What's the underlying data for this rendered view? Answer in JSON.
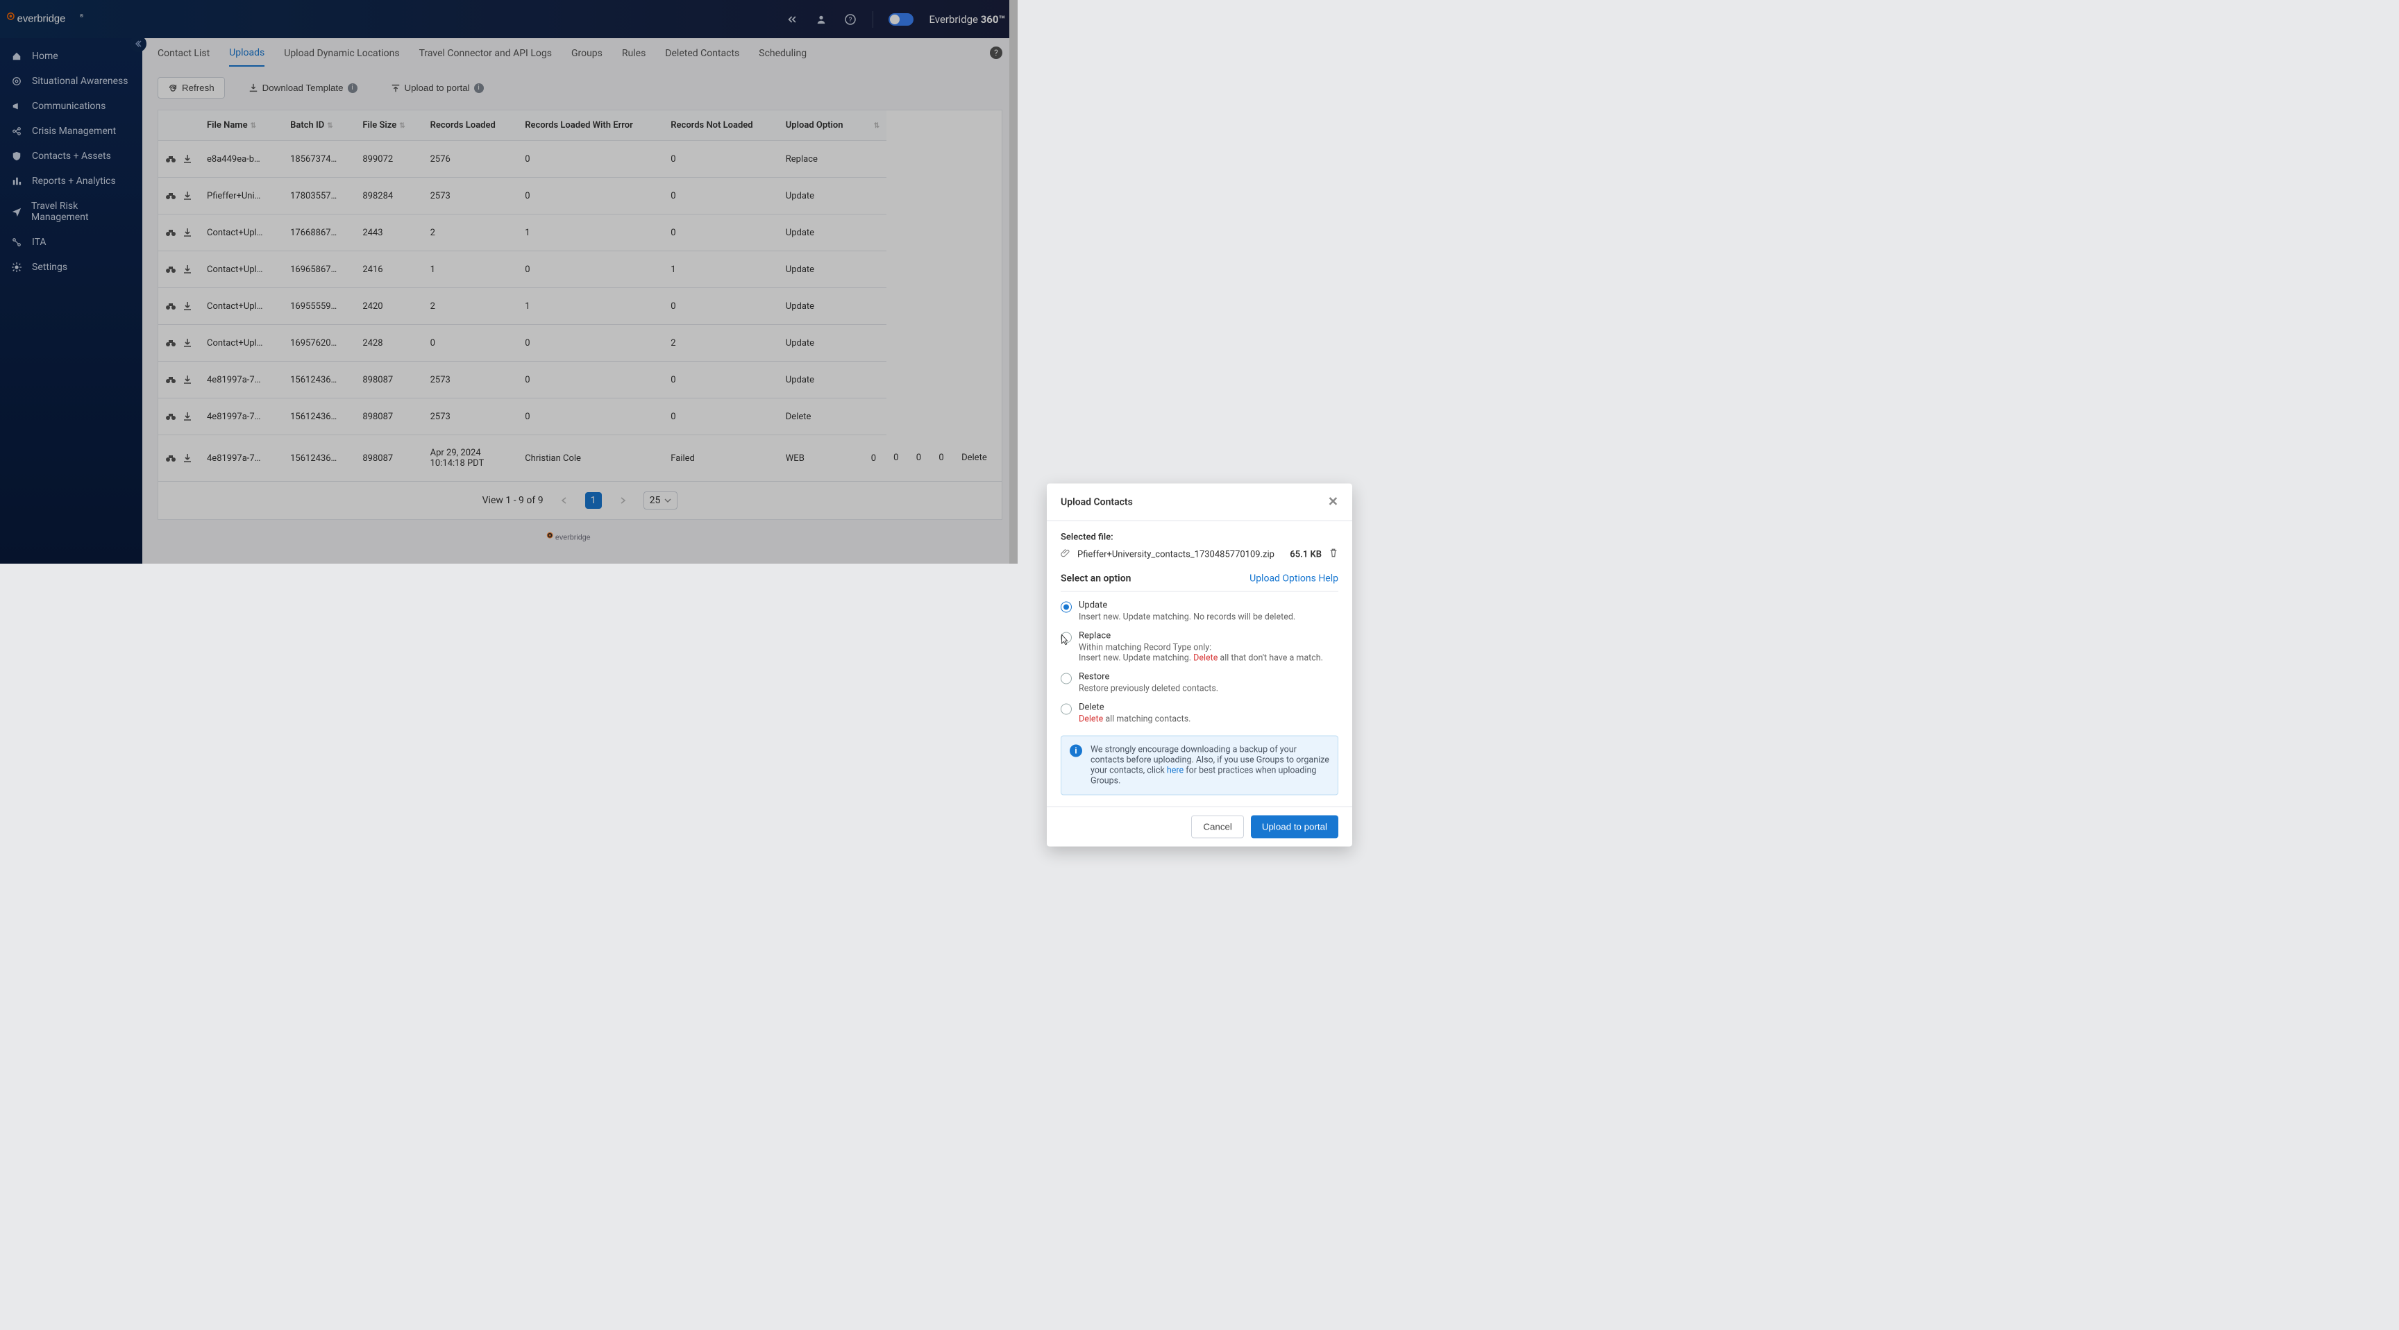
{
  "header": {
    "brand_right_prefix": "Everbridge ",
    "brand_right_suffix": "360™"
  },
  "sidebar": {
    "items": [
      {
        "label": "Home"
      },
      {
        "label": "Situational Awareness"
      },
      {
        "label": "Communications"
      },
      {
        "label": "Crisis Management"
      },
      {
        "label": "Contacts + Assets"
      },
      {
        "label": "Reports + Analytics"
      },
      {
        "label": "Travel Risk Management"
      },
      {
        "label": "ITA"
      },
      {
        "label": "Settings"
      }
    ]
  },
  "tabs": [
    "Contact List",
    "Uploads",
    "Upload Dynamic Locations",
    "Travel Connector and API Logs",
    "Groups",
    "Rules",
    "Deleted Contacts",
    "Scheduling"
  ],
  "active_tab_index": 1,
  "toolbar": {
    "refresh": "Refresh",
    "download_template": "Download Template",
    "upload_to_portal": "Upload to portal"
  },
  "columns": [
    "File Name",
    "Batch ID",
    "File Size",
    "Records Loaded",
    "Records Loaded With Error",
    "Records Not Loaded",
    "Upload Option"
  ],
  "rows": [
    {
      "file": "e8a449ea-b…",
      "batch": "18567374…",
      "size": "899072",
      "loaded": "2576",
      "err": "0",
      "not": "0",
      "opt": "Replace"
    },
    {
      "file": "Pfieffer+Uni…",
      "batch": "17803557…",
      "size": "898284",
      "loaded": "2573",
      "err": "0",
      "not": "0",
      "opt": "Update"
    },
    {
      "file": "Contact+Upl…",
      "batch": "17668867…",
      "size": "2443",
      "loaded": "2",
      "err": "1",
      "not": "0",
      "opt": "Update"
    },
    {
      "file": "Contact+Upl…",
      "batch": "16965867…",
      "size": "2416",
      "loaded": "1",
      "err": "0",
      "not": "1",
      "opt": "Update"
    },
    {
      "file": "Contact+Upl…",
      "batch": "16955559…",
      "size": "2420",
      "loaded": "2",
      "err": "1",
      "not": "0",
      "opt": "Update"
    },
    {
      "file": "Contact+Upl…",
      "batch": "16957620…",
      "size": "2428",
      "loaded": "0",
      "err": "0",
      "not": "2",
      "opt": "Update"
    },
    {
      "file": "4e81997a-7…",
      "batch": "15612436…",
      "size": "898087",
      "loaded": "2573",
      "err": "0",
      "not": "0",
      "opt": "Update"
    },
    {
      "file": "4e81997a-7…",
      "batch": "15612436…",
      "size": "898087",
      "loaded": "2573",
      "err": "0",
      "not": "0",
      "opt": "Delete"
    },
    {
      "file": "4e81997a-7…",
      "batch": "15612436…",
      "size": "898087",
      "date": "Apr 29, 2024 10:14:18 PDT",
      "by": "Christian Cole",
      "status": "Failed",
      "source": "WEB",
      "received": "0",
      "loaded": "0",
      "err": "0",
      "not": "0",
      "opt": "Delete"
    }
  ],
  "pagination": {
    "view_text": "View 1 - 9 of 9",
    "page": "1",
    "page_size": "25"
  },
  "modal": {
    "title": "Upload Contacts",
    "selected_file_label": "Selected file:",
    "file_name": "Pfieffer+University_contacts_1730485770109.zip",
    "file_size": "65.1 KB",
    "select_option_label": "Select an option",
    "upload_options_help": "Upload Options Help",
    "options": {
      "update": {
        "title": "Update",
        "sub": "Insert new. Update matching. No records will be deleted."
      },
      "replace": {
        "title": "Replace",
        "sub1": "Within matching Record Type only:",
        "sub2a": "Insert new. Update matching. ",
        "sub2_delete": "Delete",
        "sub2b": " all that don't have a match."
      },
      "restore": {
        "title": "Restore",
        "sub": "Restore previously deleted contacts."
      },
      "delete": {
        "title": "Delete",
        "sub_delete": "Delete",
        "sub_rest": " all matching contacts."
      }
    },
    "info": {
      "text_a": "We strongly encourage downloading a backup of your contacts before uploading. Also, if you use Groups to organize your contacts, click ",
      "link": "here",
      "text_b": " for best practices when uploading Groups."
    },
    "footer": {
      "cancel": "Cancel",
      "upload": "Upload to portal"
    }
  }
}
